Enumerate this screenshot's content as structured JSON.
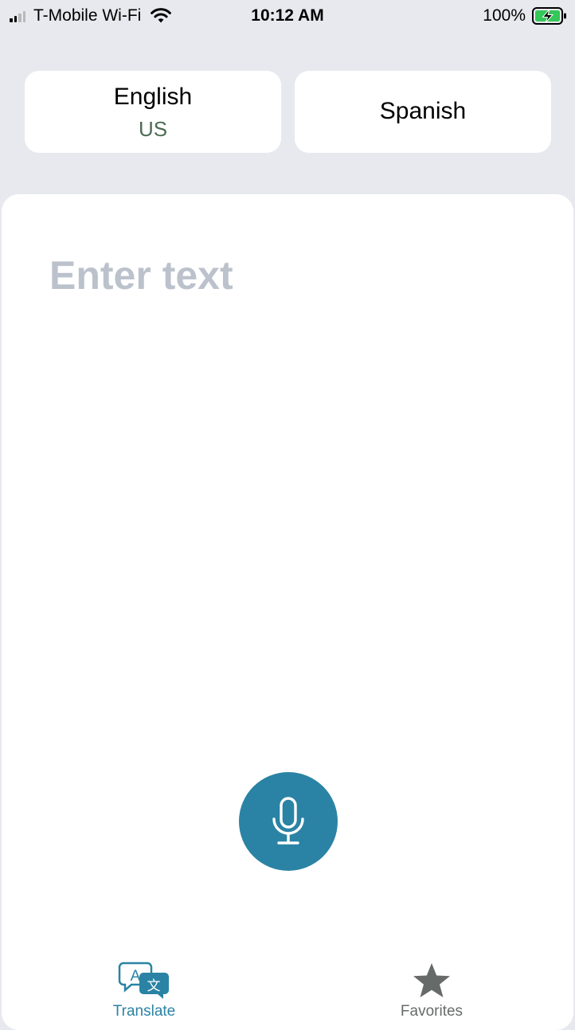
{
  "status_bar": {
    "carrier": "T-Mobile Wi-Fi",
    "time": "10:12 AM",
    "battery": "100%",
    "icons": [
      "signal-icon",
      "wifi-icon",
      "battery-charging-icon"
    ]
  },
  "languages": {
    "source": {
      "name": "English",
      "region": "US"
    },
    "target": {
      "name": "Spanish"
    }
  },
  "input": {
    "placeholder": "Enter text",
    "value": ""
  },
  "mic": {
    "icon": "microphone-icon"
  },
  "tabs": [
    {
      "label": "Translate",
      "icon": "translate-icon",
      "active": true
    },
    {
      "label": "Favorites",
      "icon": "star-icon",
      "active": false
    }
  ],
  "colors": {
    "accent": "#2a83a4",
    "background": "#e8e9ef",
    "card": "#ffffff",
    "region_text": "#4e6b55",
    "placeholder": "#bcc2cc",
    "inactive_tab": "#666b6a",
    "battery_green": "#34c759"
  }
}
